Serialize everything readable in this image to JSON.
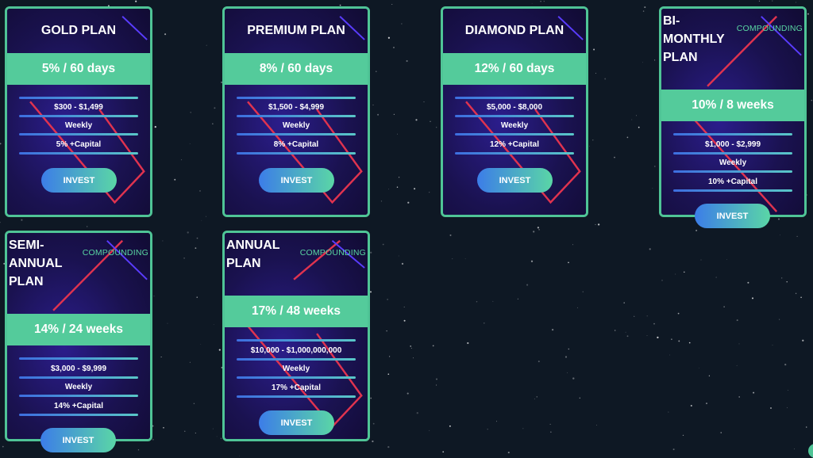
{
  "invest_label": "INVEST",
  "colors": {
    "accent_green": "#4fc496",
    "rate_band": "#54cb9b",
    "card_bg": "#1c1048",
    "page_bg": "#0e1824",
    "deco_red": "#e0334f"
  },
  "plans": [
    {
      "name": "GOLD PLAN",
      "compounding": "",
      "rate": "5% / 60 days",
      "range": "$300 - $1,499",
      "frequency": "Weekly",
      "return": "5% +Capital"
    },
    {
      "name": "PREMIUM PLAN",
      "compounding": "",
      "rate": "8% / 60 days",
      "range": "$1,500 - $4,999",
      "frequency": "Weekly",
      "return": "8% +Capital"
    },
    {
      "name": "DIAMOND PLAN",
      "compounding": "",
      "rate": "12% / 60 days",
      "range": "$5,000 - $8,000",
      "frequency": "Weekly",
      "return": "12% +Capital"
    },
    {
      "name": "BI-\nMONTHLY\nPLAN",
      "compounding": "COMPOUNDING",
      "rate": "10% / 8 weeks",
      "range": "$1,000 - $2,999",
      "frequency": "Weekly",
      "return": "10% +Capital"
    },
    {
      "name": "SEMI-\nANNUAL\nPLAN",
      "compounding": "COMPOUNDING",
      "rate": "14% / 24 weeks",
      "range": "$3,000 - $9,999",
      "frequency": "Weekly",
      "return": "14% +Capital"
    },
    {
      "name": "ANNUAL\nPLAN",
      "compounding": "COMPOUNDING",
      "rate": "17% / 48 weeks",
      "range": "$10,000 - $1,000,000,000",
      "frequency": "Weekly",
      "return": "17% +Capital"
    }
  ]
}
